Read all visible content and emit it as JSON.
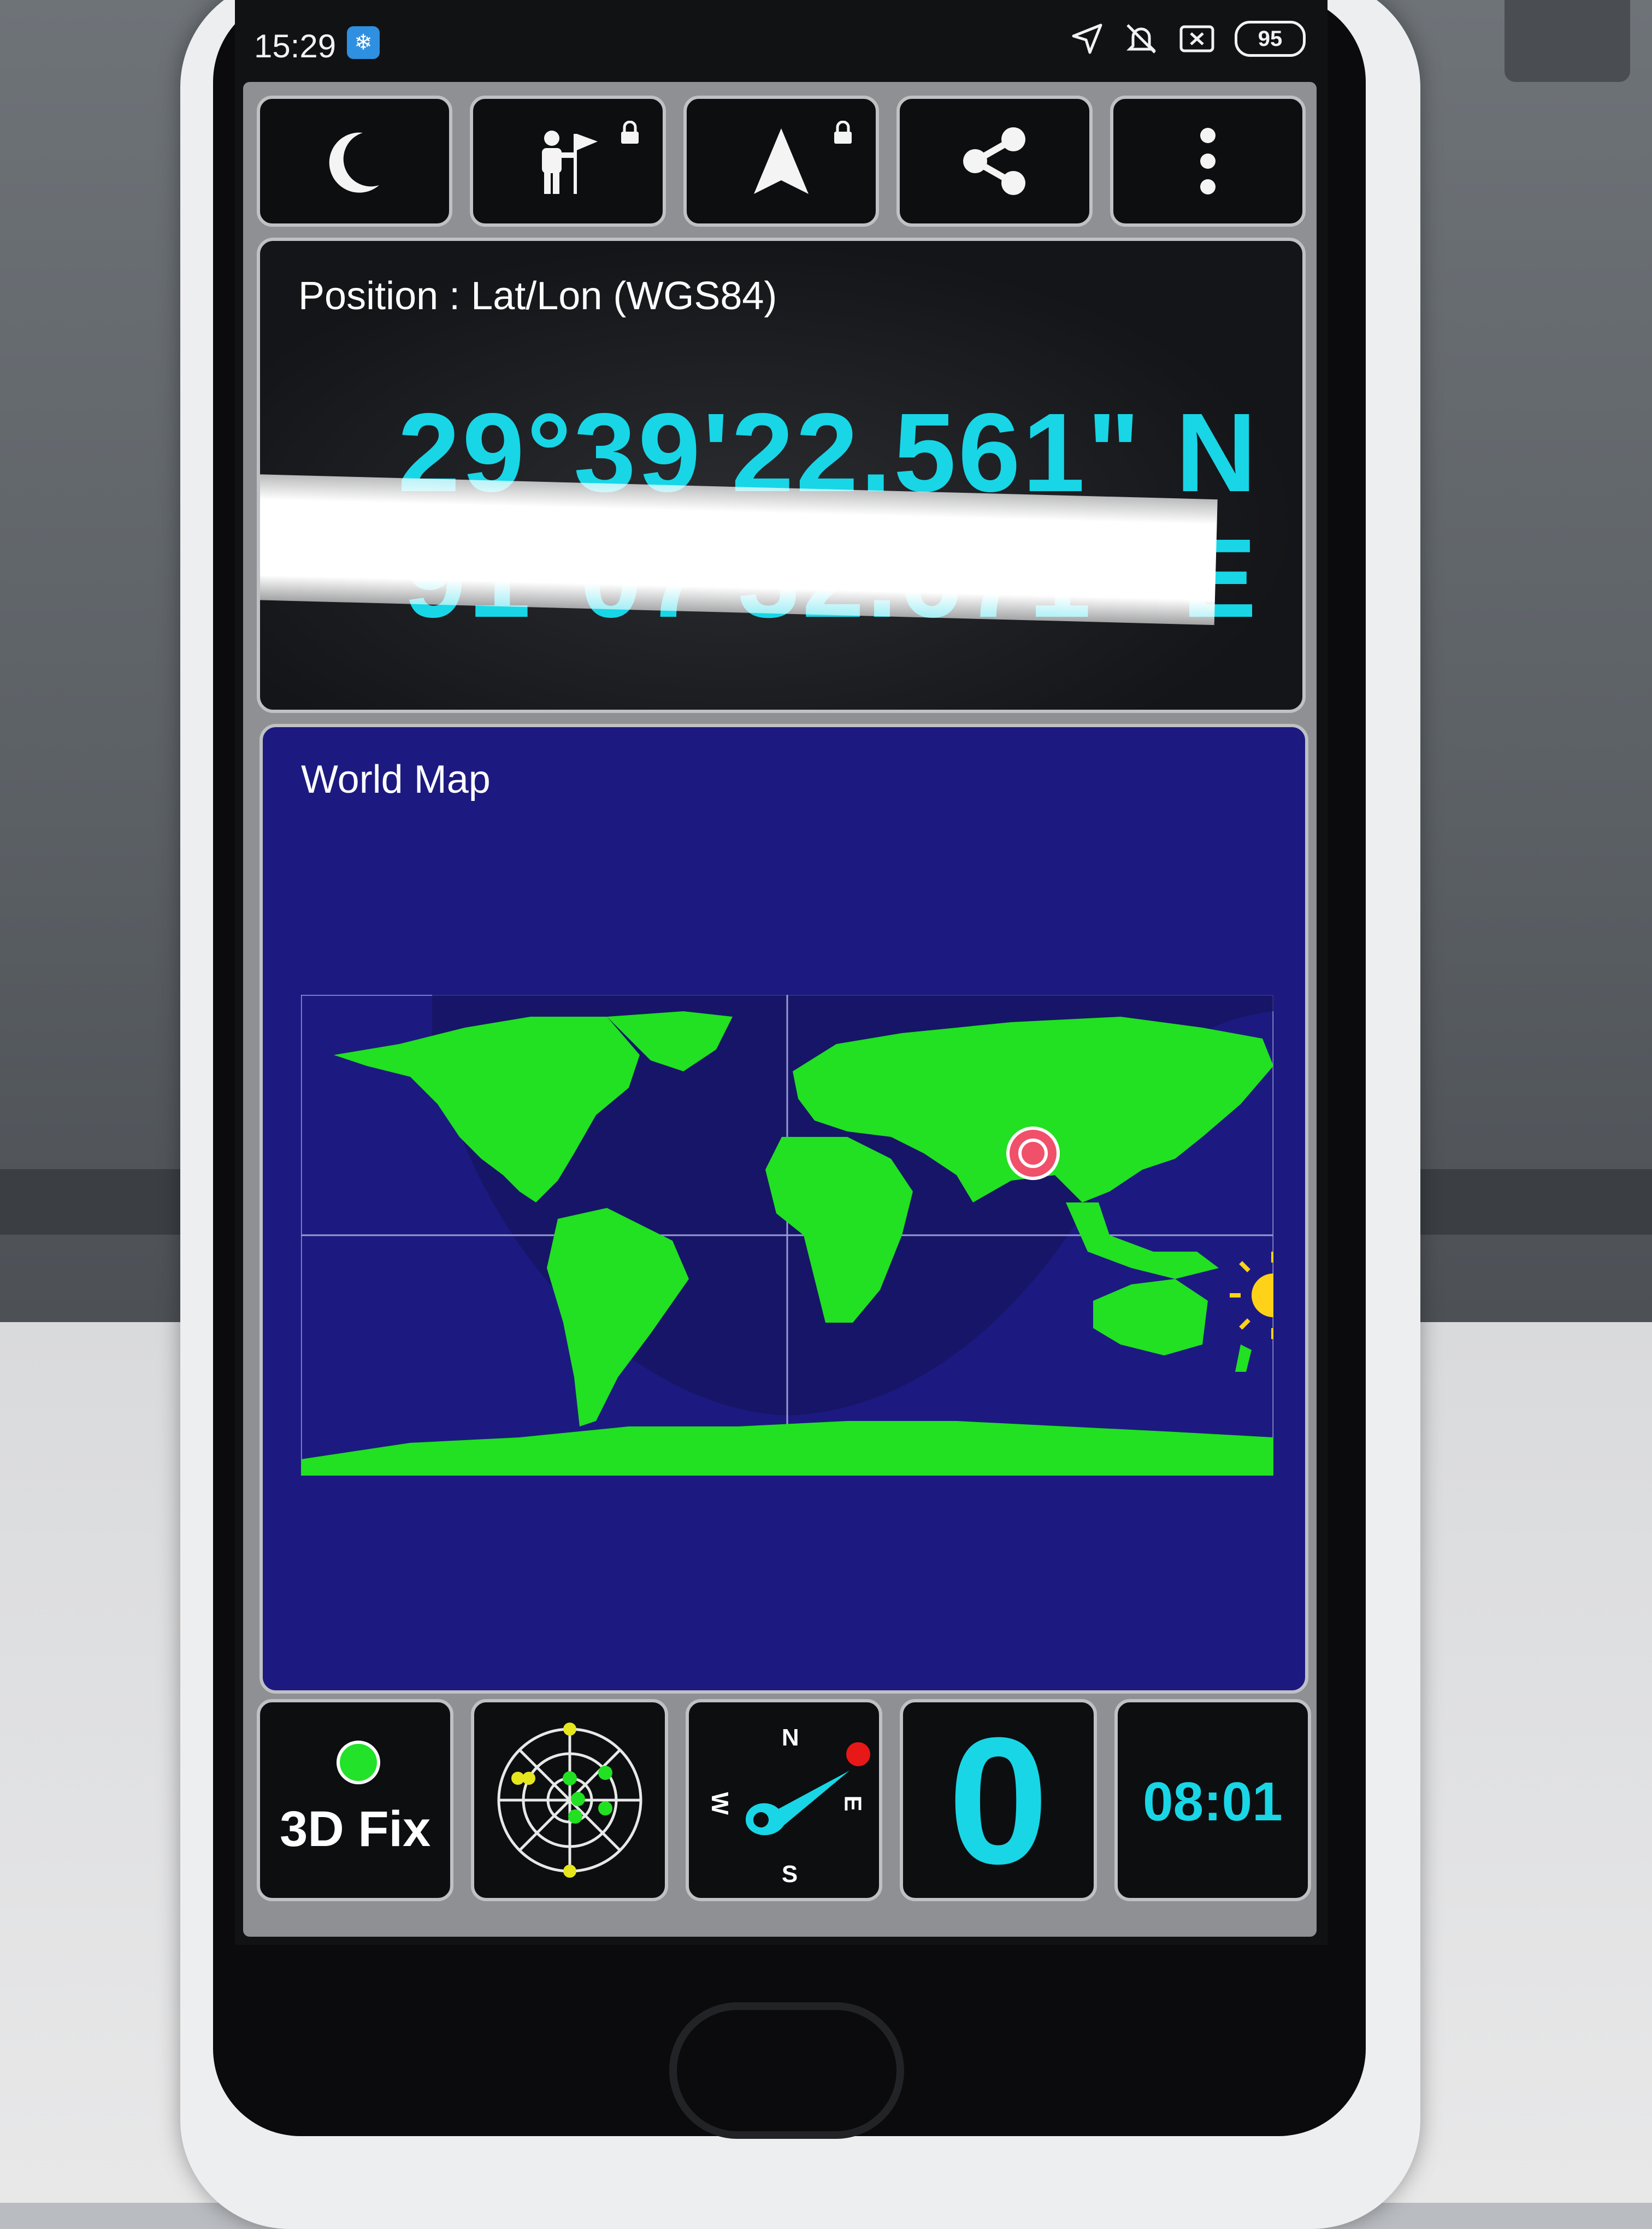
{
  "status_bar": {
    "time": "15:29",
    "battery": "95",
    "icons": [
      "location-arrow-icon",
      "mute-icon",
      "no-sim-icon"
    ]
  },
  "toolbar": {
    "buttons": [
      {
        "name": "night-mode-button",
        "icon": "moon-icon"
      },
      {
        "name": "waypoint-button",
        "icon": "person-flag-icon",
        "locked": true
      },
      {
        "name": "navigate-button",
        "icon": "navigation-arrow-icon",
        "locked": true
      },
      {
        "name": "share-button",
        "icon": "share-icon"
      },
      {
        "name": "more-menu-button",
        "icon": "vertical-dots-icon"
      }
    ]
  },
  "position": {
    "title": "Position : Lat/Lon (WGS84)",
    "latitude": "29°39'22.561\" N",
    "longitude": "91°07'32.671\" E"
  },
  "world_map": {
    "title": "World Map",
    "land_color": "#22e022",
    "ocean_color": "#1c1a80",
    "marker_color": "#f0506a"
  },
  "bottom_bar": {
    "fix_status": "3D Fix",
    "fix_indicator_color": "#22e22a",
    "compass": {
      "n": "N",
      "s": "S",
      "w": "W",
      "e": "E"
    },
    "speed": "0",
    "elapsed_time": "08:01"
  },
  "colors": {
    "accent": "#18d6e6",
    "panel_border": "#bfc1c4",
    "button_bg": "#0d0e10"
  }
}
